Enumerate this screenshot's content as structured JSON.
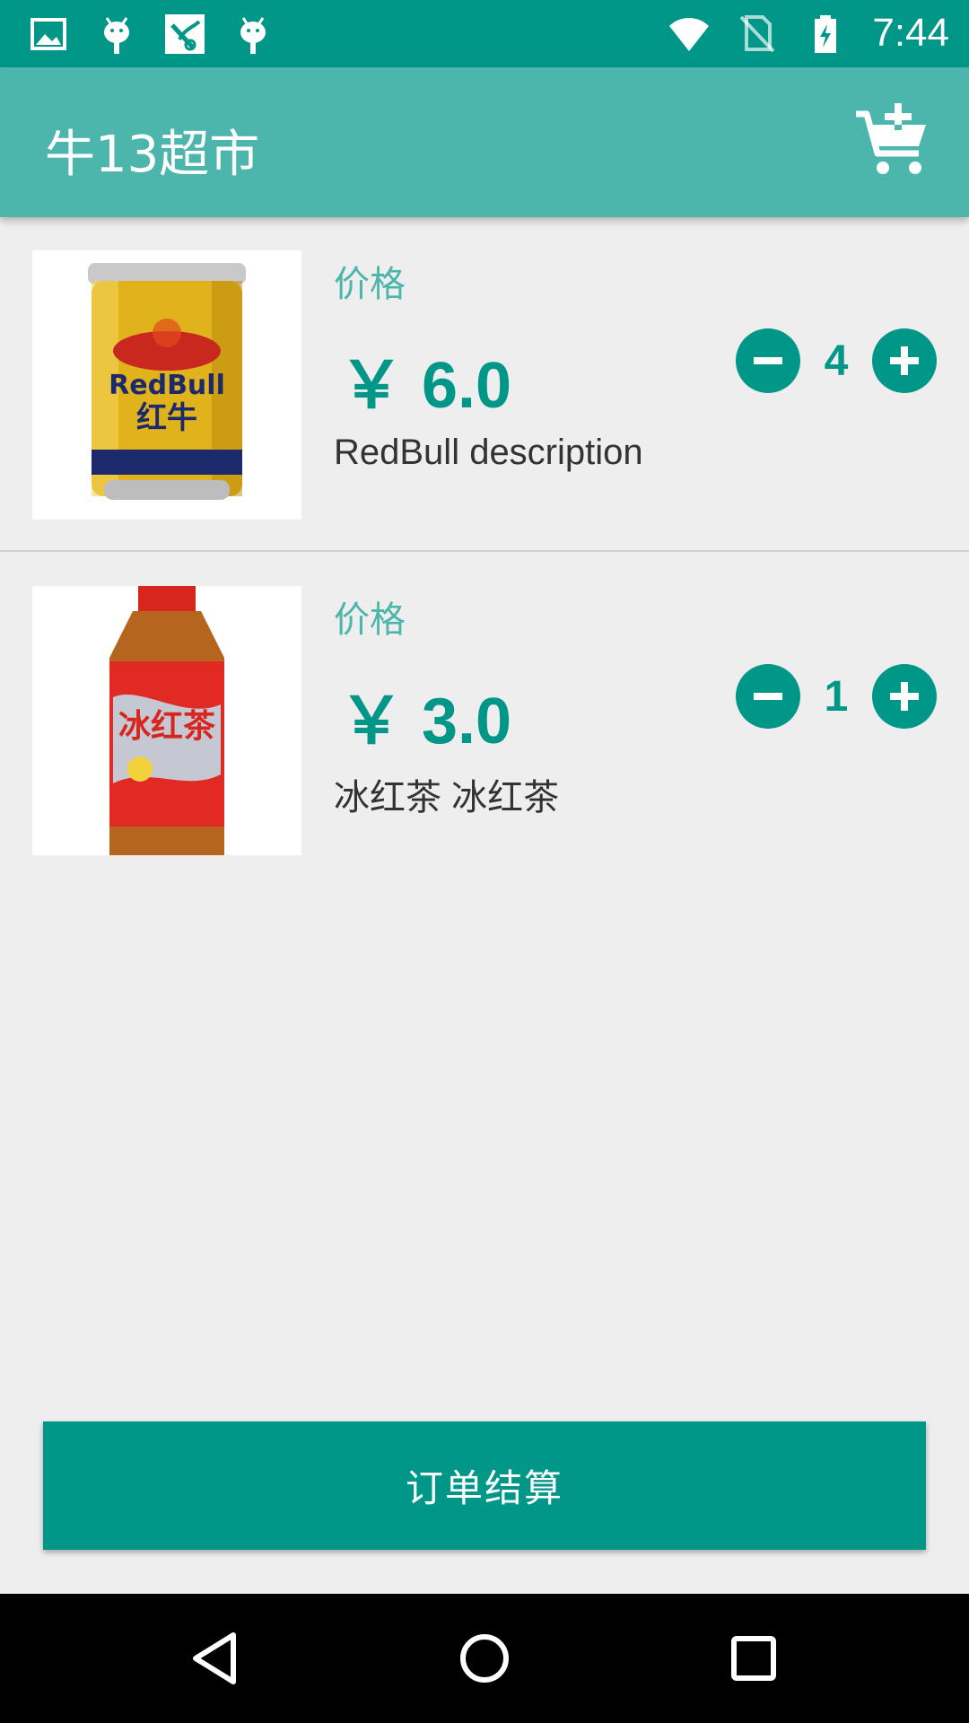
{
  "status_bar": {
    "time": "7:44",
    "left_icons": [
      "image-icon",
      "android-icon",
      "app-icon",
      "android-icon"
    ],
    "right_icons": [
      "wifi-icon",
      "no-sim-icon",
      "battery-charging-icon"
    ]
  },
  "app_bar": {
    "title": "牛13超市",
    "cart_icon": "add-to-cart-icon"
  },
  "products": [
    {
      "price_label": "价格",
      "price": "￥ 6.0",
      "quantity": "4",
      "description": "RedBull description",
      "image": "redbull-can-image"
    },
    {
      "price_label": "价格",
      "price": "￥ 3.0",
      "quantity": "1",
      "description": "冰红茶 冰红茶",
      "image": "ice-tea-bottle-image"
    }
  ],
  "checkout": {
    "label": "订单结算"
  },
  "nav_bar": {
    "icons": [
      "back-icon",
      "home-icon",
      "recents-icon"
    ]
  },
  "colors": {
    "primary_dark": "#009688",
    "primary": "#4db6ac",
    "background": "#eeeeee"
  }
}
